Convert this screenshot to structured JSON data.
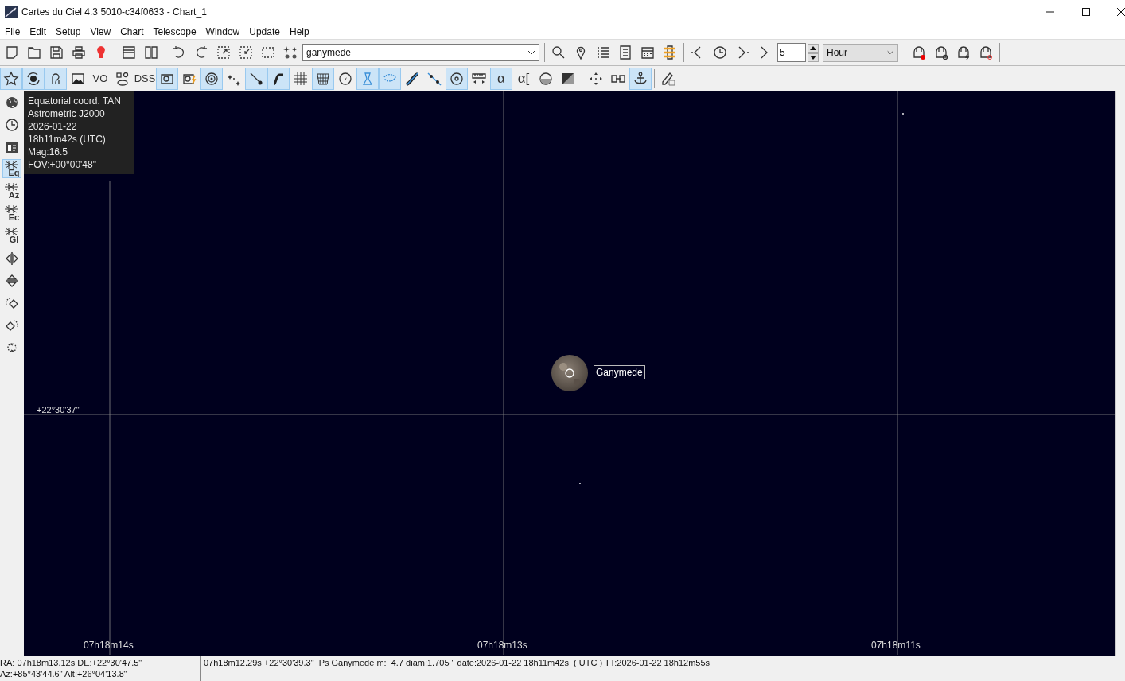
{
  "window": {
    "title": "Cartes du Ciel 4.3 5010-c34f0633 - Chart_1"
  },
  "menu": [
    "File",
    "Edit",
    "Setup",
    "View",
    "Chart",
    "Telescope",
    "Window",
    "Update",
    "Help"
  ],
  "toolbar": {
    "search_value": "ganymede",
    "step_value": "5",
    "step_unit": "Hour"
  },
  "toolbar2": [
    {
      "selected": true
    },
    {
      "selected": true
    },
    {
      "selected": true
    },
    {
      "selected": false
    },
    {
      "label": "VO",
      "selected": false
    },
    {
      "selected": false
    },
    {
      "label": "DSS",
      "selected": false
    },
    {
      "selected": true
    },
    {
      "selected": false
    },
    {
      "selected": true
    },
    {
      "selected": false
    },
    {
      "selected": true
    },
    {
      "selected": true
    },
    {
      "selected": false
    },
    {
      "selected": true
    },
    {
      "selected": false
    },
    {
      "selected": true
    },
    {
      "selected": true
    },
    {
      "selected": false
    },
    {
      "selected": false
    },
    {
      "selected": true
    },
    {
      "selected": false
    },
    {
      "label": "α",
      "selected": true
    },
    {
      "label": "α[",
      "selected": false
    },
    {
      "selected": false
    },
    {
      "selected": false
    },
    {
      "selected": false
    },
    {
      "selected": false
    },
    {
      "selected": true
    },
    {
      "selected": false
    }
  ],
  "sidebar": [
    {
      "selected": false
    },
    {
      "selected": false
    },
    {
      "selected": false
    },
    {
      "label": "Eq",
      "selected": true
    },
    {
      "label": "Az",
      "selected": false
    },
    {
      "label": "Ec",
      "selected": false
    },
    {
      "label": "Gl",
      "selected": false
    },
    {
      "selected": false
    },
    {
      "selected": false
    },
    {
      "selected": false
    },
    {
      "selected": false
    },
    {
      "selected": false
    }
  ],
  "chart": {
    "info": [
      "Equatorial coord. TAN",
      "Astrometric J2000",
      "2026-01-22",
      "18h11m42s (UTC)",
      "Mag:16.5",
      "FOV:+00°00'48\""
    ],
    "dec_label": "+22°30'37\"",
    "ra_labels": [
      "07h18m14s",
      "07h18m13s",
      "07h18m11s"
    ],
    "object_label": "Ganymede"
  },
  "status_bar": {
    "cursor_lines": [
      "RA: 07h18m13.12s DE:+22°30'47.5\"",
      "Az:+85°43'44.6\" Alt:+26°04'13.8\""
    ],
    "object_info": "07h18m12.29s +22°30'39.3\"  Ps Ganymede m:  4.7 diam:1.705 \" date:2026-01-22 18h11m42s  ( UTC ) TT:2026-01-22 18h12m55s"
  }
}
